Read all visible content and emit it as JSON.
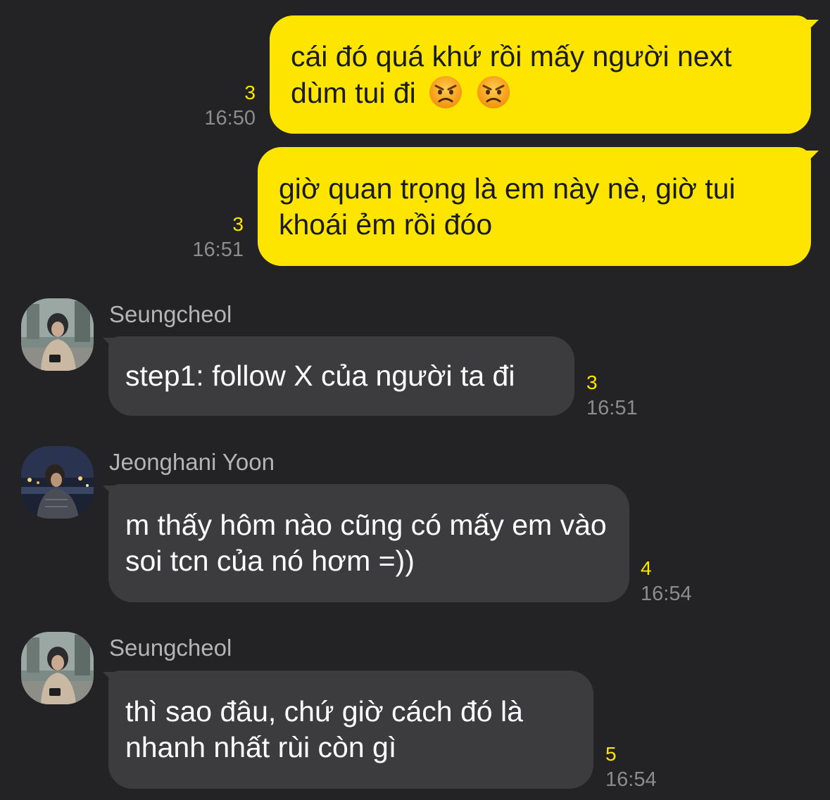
{
  "messages": [
    {
      "direction": "out",
      "text": "cái đó quá khứ rồi mấy người next dùm tui đi",
      "emoji": [
        "angry-face",
        "angry-face"
      ],
      "unread": "3",
      "time": "16:50"
    },
    {
      "direction": "out",
      "text": "giờ quan trọng là em này nè, giờ tui khoái ẻm rồi đóo",
      "unread": "3",
      "time": "16:51"
    },
    {
      "direction": "in",
      "sender": "Seungcheol",
      "avatar": "seungcheol-avatar",
      "text": "step1: follow X của người ta đi",
      "unread": "3",
      "time": "16:51"
    },
    {
      "direction": "in",
      "sender": "Jeonghani Yoon",
      "avatar": "jeonghani-avatar",
      "text": "m thấy hôm nào cũng có mấy em vào soi tcn của nó hơm =))",
      "unread": "4",
      "time": "16:54"
    },
    {
      "direction": "in",
      "sender": "Seungcheol",
      "avatar": "seungcheol-avatar",
      "text": "thì sao đâu, chứ giờ cách đó là nhanh nhất rùi còn gì",
      "unread": "5",
      "time": "16:54"
    }
  ],
  "colors": {
    "background": "#232325",
    "outgoing_bubble": "#fee500",
    "incoming_bubble": "#3c3c3e",
    "unread_count": "#fee500",
    "timestamp": "#8c8c8e",
    "sender_name": "#b4b4b6"
  }
}
